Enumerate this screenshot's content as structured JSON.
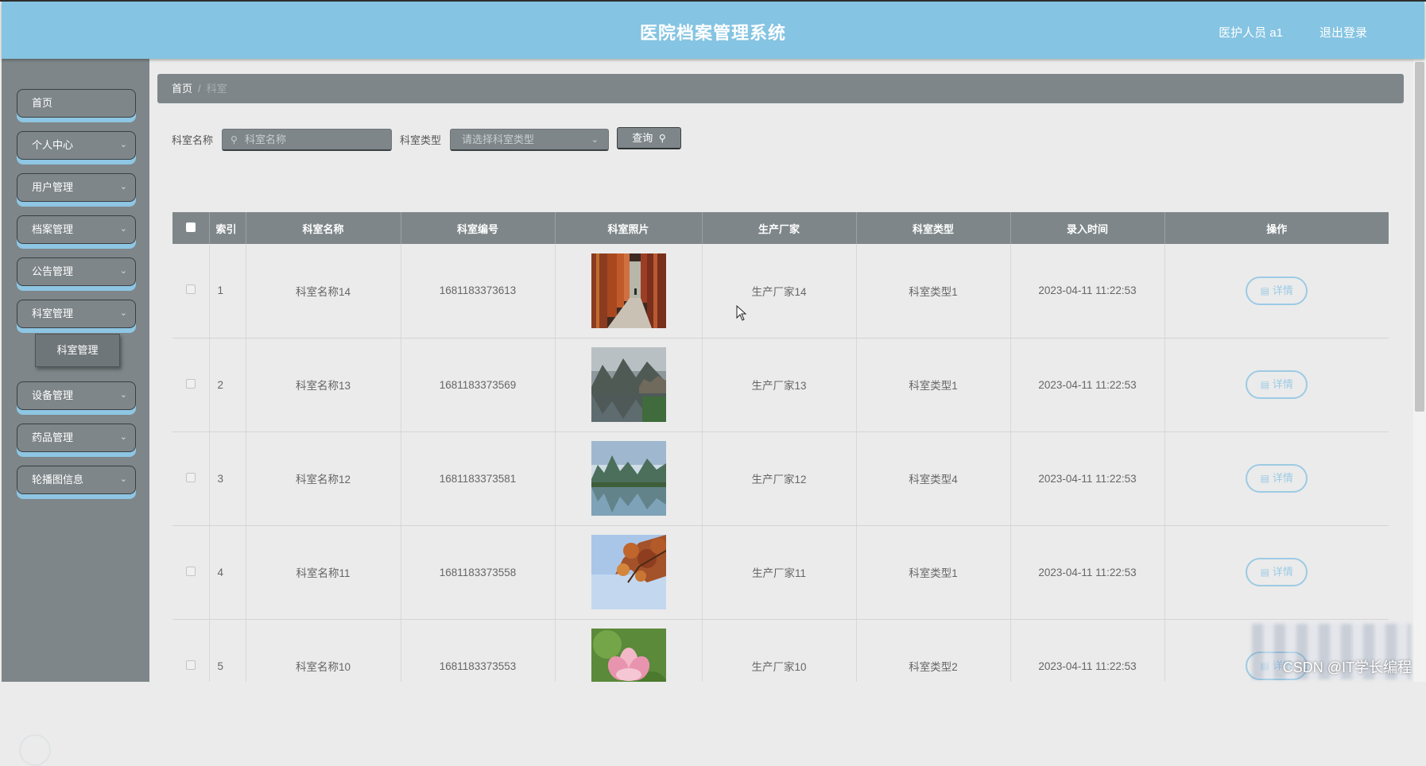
{
  "header": {
    "title": "医院档案管理系统",
    "user": "医护人员 a1",
    "logout": "退出登录"
  },
  "sidebar": {
    "items": [
      {
        "label": "首页",
        "has_arrow": false
      },
      {
        "label": "个人中心",
        "has_arrow": true
      },
      {
        "label": "用户管理",
        "has_arrow": true
      },
      {
        "label": "档案管理",
        "has_arrow": true
      },
      {
        "label": "公告管理",
        "has_arrow": true
      },
      {
        "label": "科室管理",
        "has_arrow": true
      },
      {
        "label": "设备管理",
        "has_arrow": true
      },
      {
        "label": "药品管理",
        "has_arrow": true
      },
      {
        "label": "轮播图信息",
        "has_arrow": true
      }
    ],
    "submenu_active": "科室管理"
  },
  "breadcrumb": {
    "home": "首页",
    "separator": "/",
    "current": "科室"
  },
  "search": {
    "name_label": "科室名称",
    "name_placeholder": "科室名称",
    "type_label": "科室类型",
    "type_placeholder": "请选择科室类型",
    "query_label": "查询"
  },
  "table": {
    "headers": [
      "",
      "索引",
      "科室名称",
      "科室编号",
      "科室照片",
      "生产厂家",
      "科室类型",
      "录入时间",
      "操作"
    ],
    "rows": [
      {
        "index": "1",
        "name": "科室名称14",
        "code": "1681183373613",
        "photo": "corridor",
        "maker": "生产厂家14",
        "type": "科室类型1",
        "time": "2023-04-11 11:22:53",
        "action": "详情"
      },
      {
        "index": "2",
        "name": "科室名称13",
        "code": "1681183373569",
        "photo": "lake-village",
        "maker": "生产厂家13",
        "type": "科室类型1",
        "time": "2023-04-11 11:22:53",
        "action": "详情"
      },
      {
        "index": "3",
        "name": "科室名称12",
        "code": "1681183373581",
        "photo": "karst-river",
        "maker": "生产厂家12",
        "type": "科室类型4",
        "time": "2023-04-11 11:22:53",
        "action": "详情"
      },
      {
        "index": "4",
        "name": "科室名称11",
        "code": "1681183373558",
        "photo": "autumn-leaves",
        "maker": "生产厂家11",
        "type": "科室类型1",
        "time": "2023-04-11 11:22:53",
        "action": "详情"
      },
      {
        "index": "5",
        "name": "科室名称10",
        "code": "1681183373553",
        "photo": "lotus",
        "maker": "生产厂家10",
        "type": "科室类型2",
        "time": "2023-04-11 11:22:53",
        "action": "详情"
      }
    ]
  },
  "watermark": "CSDN @IT学长编程",
  "colors": {
    "header_bg": "#85c4e2",
    "panel_gray": "#7e8689",
    "accent_blue": "#9ccbe4",
    "page_bg": "#ebebeb"
  }
}
